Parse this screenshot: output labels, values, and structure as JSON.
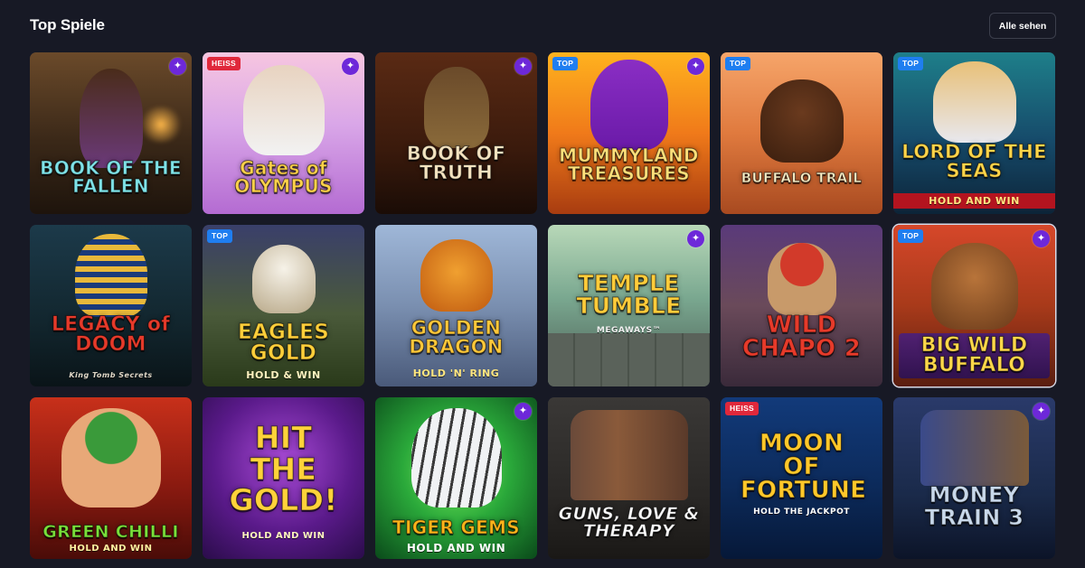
{
  "section": {
    "title": "Top Spiele",
    "see_all_label": "Alle sehen"
  },
  "games": [
    {
      "title": "BOOK OF THE FALLEN",
      "subtitle": "",
      "badge": "",
      "star": true
    },
    {
      "title": "Gates of OLYMPUS",
      "subtitle": "",
      "badge": "HEISS",
      "star": true
    },
    {
      "title": "BOOK OF TRUTH",
      "subtitle": "",
      "badge": "",
      "star": true
    },
    {
      "title": "MUMMYLAND TREASURES",
      "subtitle": "",
      "badge": "TOP",
      "star": true
    },
    {
      "title": "BUFFALO TRAIL",
      "subtitle": "",
      "badge": "TOP",
      "star": false
    },
    {
      "title": "LORD OF THE SEAS",
      "subtitle": "HOLD AND WIN",
      "badge": "TOP",
      "star": false
    },
    {
      "title": "LEGACY of DOOM",
      "subtitle": "King Tomb Secrets",
      "badge": "",
      "star": false
    },
    {
      "title": "EAGLES GOLD",
      "subtitle": "HOLD & WIN",
      "badge": "TOP",
      "star": false
    },
    {
      "title": "GOLDEN DRAGON",
      "subtitle": "HOLD 'N' RING",
      "badge": "",
      "star": false
    },
    {
      "title": "TEMPLE TUMBLE",
      "subtitle": "MEGAWAYS™",
      "badge": "",
      "star": true
    },
    {
      "title": "WILD CHAPO 2",
      "subtitle": "",
      "badge": "",
      "star": false
    },
    {
      "title": "BIG WILD BUFFALO",
      "subtitle": "",
      "badge": "TOP",
      "star": true
    },
    {
      "title": "GREEN CHILLI",
      "subtitle": "HOLD AND WIN",
      "badge": "",
      "star": false
    },
    {
      "title": "HIT THE GOLD!",
      "subtitle": "HOLD AND WIN",
      "badge": "",
      "star": false
    },
    {
      "title": "TIGER GEMS",
      "subtitle": "HOLD AND WIN",
      "badge": "",
      "star": true
    },
    {
      "title": "GUNS, LOVE & THERAPY",
      "subtitle": "",
      "badge": "",
      "star": false
    },
    {
      "title": "MOON OF FORTUNE",
      "subtitle": "HOLD THE JACKPOT",
      "badge": "HEISS",
      "star": false
    },
    {
      "title": "MONEY TRAIN 3",
      "subtitle": "",
      "badge": "",
      "star": true
    }
  ],
  "icons": {
    "star": "sparkle-icon"
  },
  "colors": {
    "page_bg": "#171925",
    "badge_top": "#1f7ef0",
    "badge_hot": "#e0283b",
    "star_bg": "#6d28d9"
  }
}
